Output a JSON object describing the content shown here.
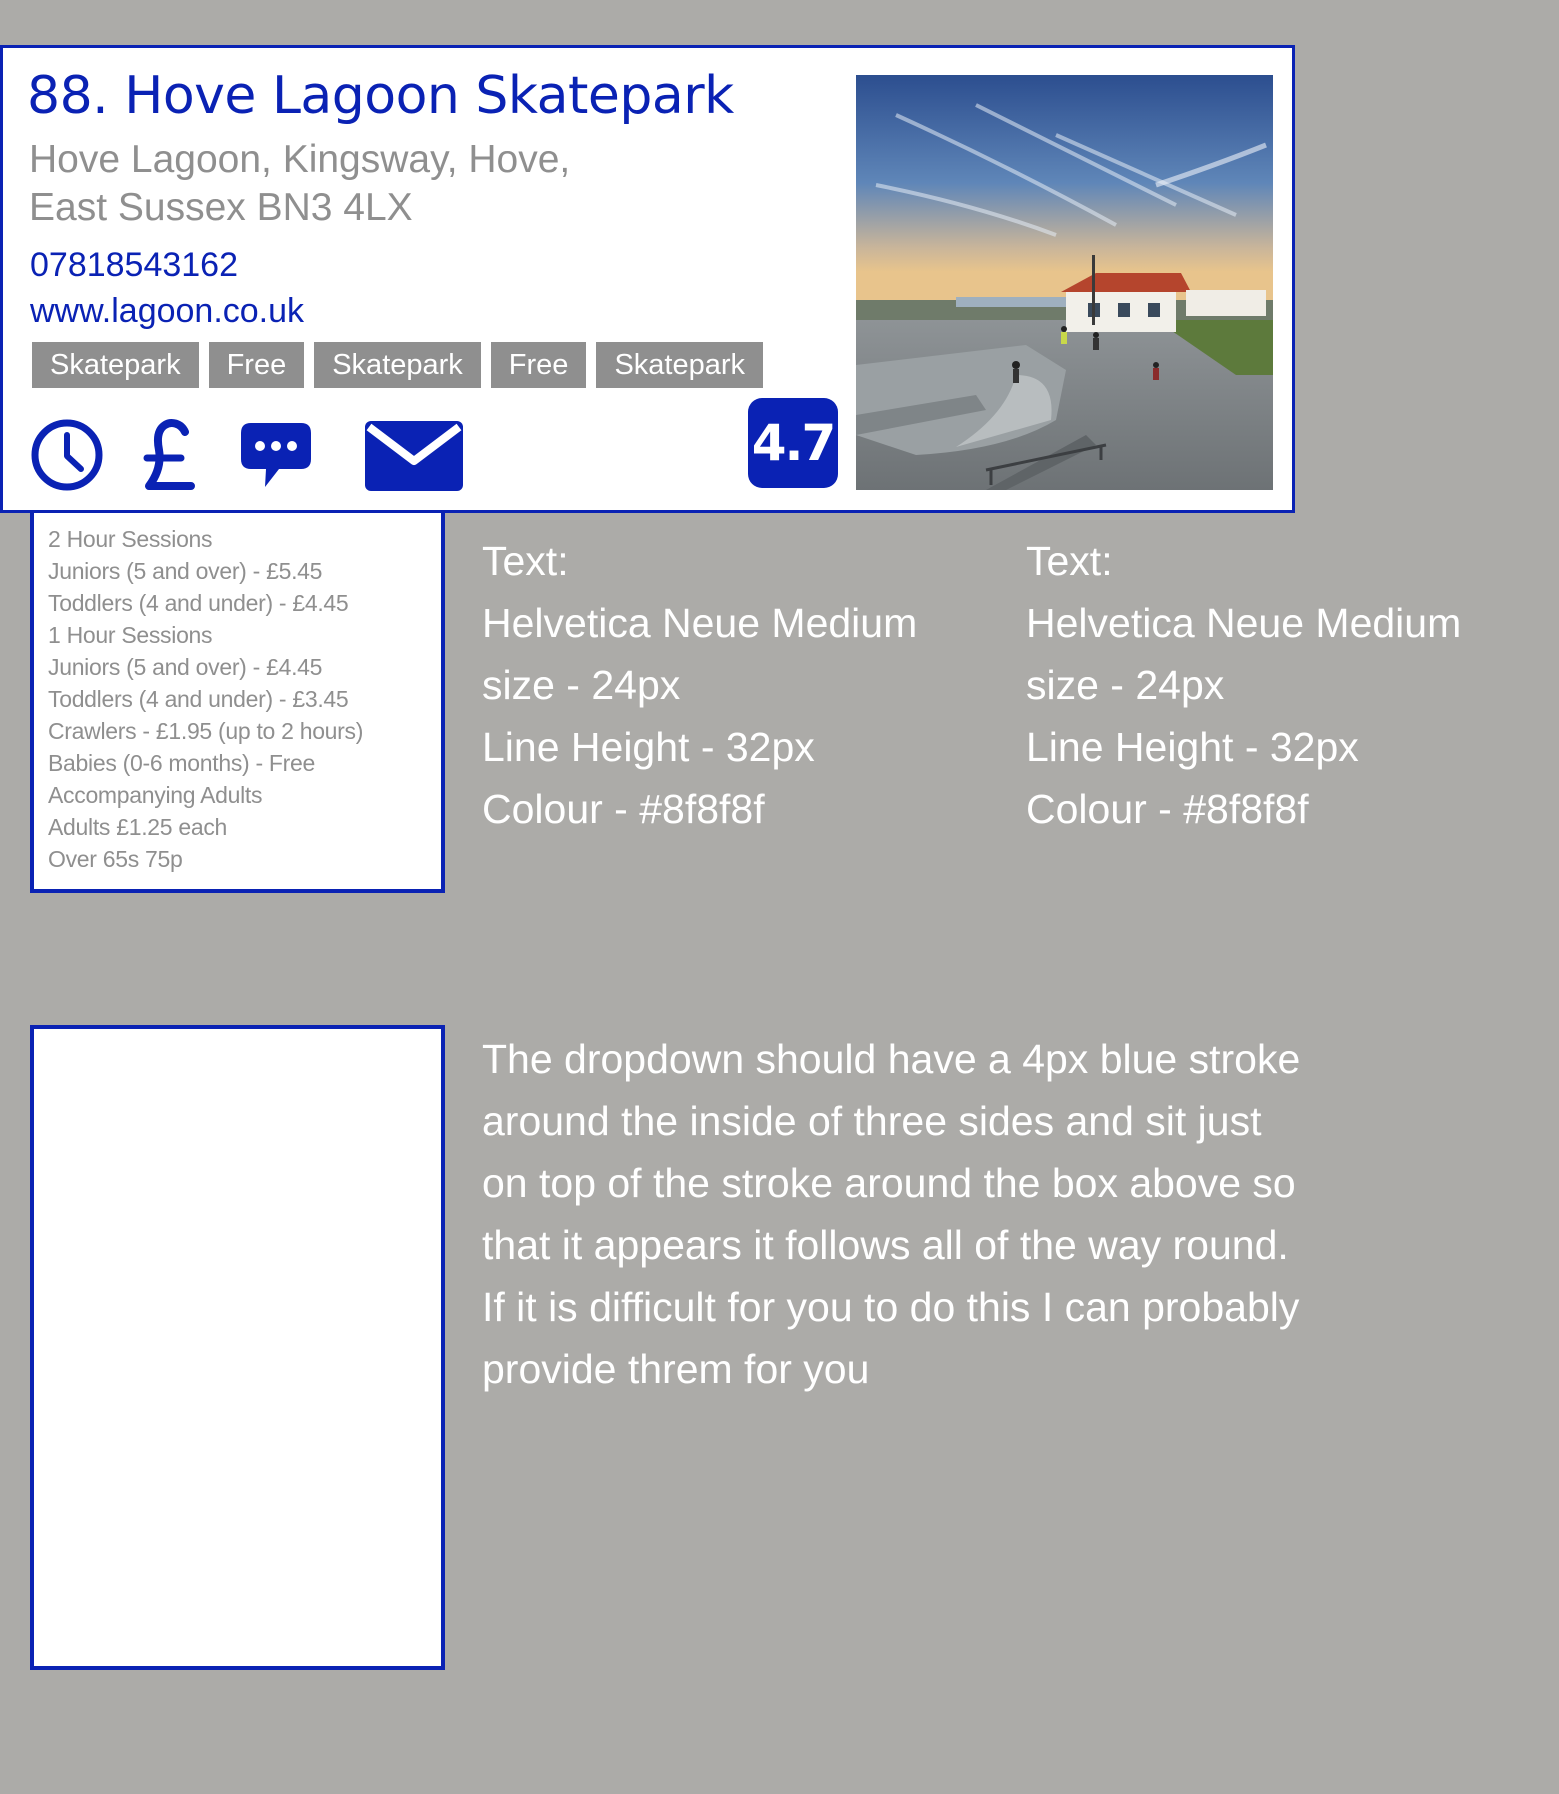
{
  "venue": {
    "title": "88. Hove Lagoon Skatepark",
    "address_line1": "Hove Lagoon, Kingsway, Hove,",
    "address_line2": "East Sussex BN3 4LX",
    "phone": "07818543162",
    "website": "www.lagoon.co.uk",
    "tags": [
      "Skatepark",
      "Free",
      "Skatepark",
      "Free",
      "Skatepark"
    ],
    "rating": "4.7",
    "icons": [
      "clock-icon",
      "pound-icon",
      "chat-icon",
      "mail-icon"
    ]
  },
  "prices": [
    "2 Hour Sessions",
    "Juniors (5 and over) - £5.45",
    "Toddlers (4 and under) - £4.45",
    "1 Hour Sessions",
    "Juniors (5 and over) - £4.45",
    "Toddlers (4 and under) - £3.45",
    "Crawlers - £1.95 (up to 2 hours)",
    "Babies (0-6 months) - Free",
    "Accompanying Adults",
    "Adults £1.25 each",
    "Over 65s 75p"
  ],
  "spec_left": {
    "line1": "Text:",
    "line2": "Helvetica Neue Medium",
    "line3": "size - 24px",
    "line4": "Line Height - 32px",
    "line5": "Colour - #8f8f8f"
  },
  "spec_right": {
    "line1": "Text:",
    "line2": "Helvetica Neue Medium",
    "line3": "size - 24px",
    "line4": "Line Height - 32px",
    "line5": "Colour - #8f8f8f"
  },
  "note": [
    "The dropdown should have a 4px blue stroke",
    "around the inside of three sides and sit just",
    "on top of the stroke around the box above so",
    "that it appears it follows all of the way round.",
    "If it is difficult for you to do this I can probably",
    "provide threm for you"
  ],
  "colors": {
    "accent_blue": "#0a22b4",
    "text_grey": "#8f8f8f",
    "background": "#acaba8"
  }
}
